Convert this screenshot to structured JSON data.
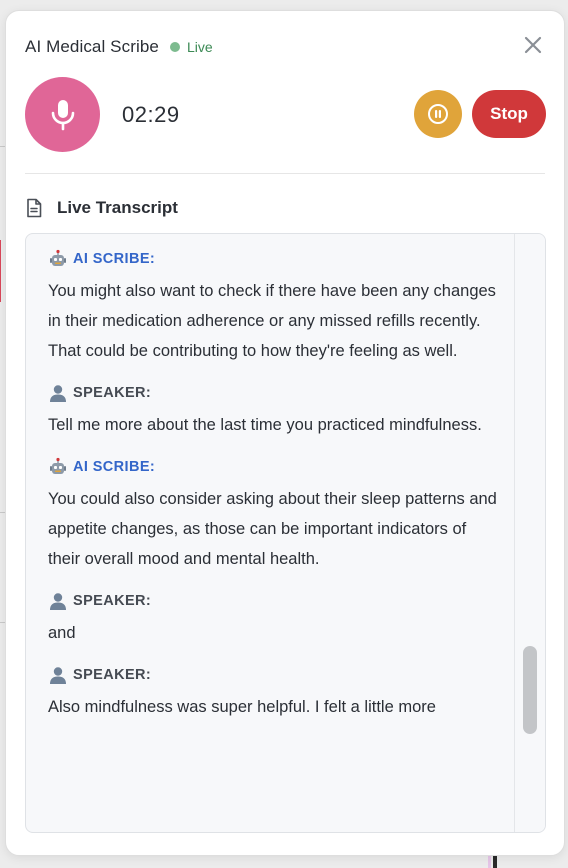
{
  "header": {
    "title": "AI Medical Scribe",
    "status": "Live",
    "status_color": "#7dbb8f",
    "close_icon": "close-icon"
  },
  "recording": {
    "mic_icon": "microphone-icon",
    "timer": "02:29",
    "pause_icon": "pause-icon",
    "stop_label": "Stop",
    "colors": {
      "mic": "#e06697",
      "pause": "#e0a43a",
      "stop": "#d0383a"
    }
  },
  "transcript": {
    "heading": "Live Transcript",
    "heading_icon": "document-icon",
    "entries": [
      {
        "speaker": "AI SCRIBE:",
        "icon": "robot-icon",
        "text": "You might also want to check if there have been any changes in their medication adherence or any missed refills recently. That could be contributing to how they're feeling as well."
      },
      {
        "speaker": "SPEAKER:",
        "icon": "person-icon",
        "text": "Tell me more about the last time you practiced mindfulness."
      },
      {
        "speaker": "AI SCRIBE:",
        "icon": "robot-icon",
        "text": "You could also consider asking about their sleep patterns and appetite changes, as those can be important indicators of their overall mood and mental health."
      },
      {
        "speaker": "SPEAKER:",
        "icon": "person-icon",
        "text": "and"
      },
      {
        "speaker": "SPEAKER:",
        "icon": "person-icon",
        "text": "Also mindfulness was super helpful. I felt a little more"
      }
    ]
  }
}
